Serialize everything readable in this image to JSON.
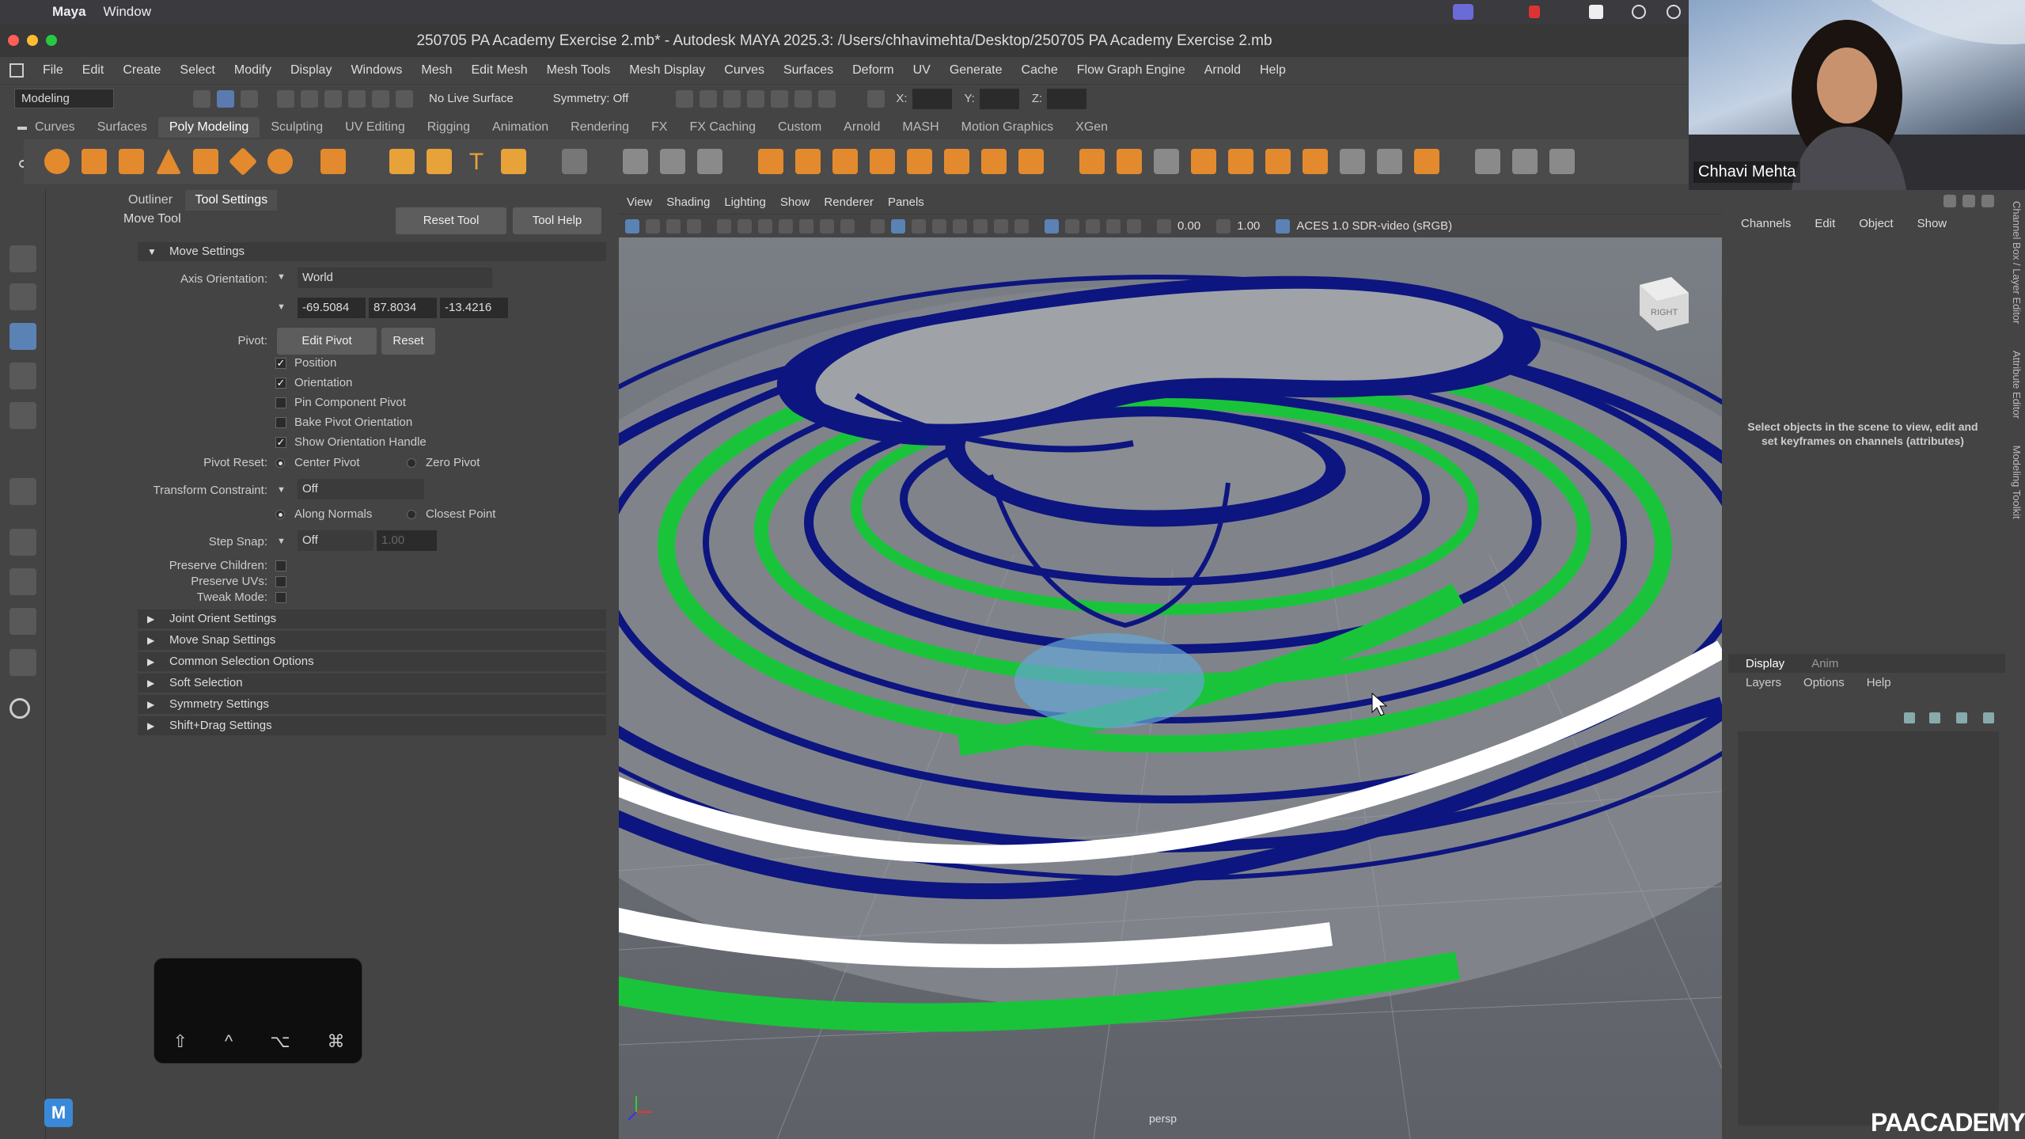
{
  "os_menu": {
    "app": "Maya",
    "window": "Window"
  },
  "window": {
    "title": "250705 PA Academy Exercise 2.mb* - Autodesk MAYA 2025.3: /Users/chhavimehta/Desktop/250705 PA Academy Exercise 2.mb"
  },
  "app_menu": [
    "File",
    "Edit",
    "Create",
    "Select",
    "Modify",
    "Display",
    "Windows",
    "Mesh",
    "Edit Mesh",
    "Mesh Tools",
    "Mesh Display",
    "Curves",
    "Surfaces",
    "Deform",
    "UV",
    "Generate",
    "Cache",
    "Flow Graph Engine",
    "Arnold",
    "Help"
  ],
  "status_line": {
    "workspace": "Modeling",
    "live_surface": "No Live Surface",
    "symmetry": "Symmetry: Off",
    "x_label": "X:",
    "y_label": "Y:",
    "z_label": "Z:"
  },
  "shelf_tabs": [
    "Curves",
    "Surfaces",
    "Poly Modeling",
    "Sculpting",
    "UV Editing",
    "Rigging",
    "Animation",
    "Rendering",
    "FX",
    "FX Caching",
    "Custom",
    "Arnold",
    "MASH",
    "Motion Graphics",
    "XGen"
  ],
  "shelf_active": "Poly Modeling",
  "panel": {
    "tabs": [
      "Outliner",
      "Tool Settings"
    ],
    "tool_name": "Move Tool",
    "reset_tool": "Reset Tool",
    "tool_help": "Tool Help",
    "section_title": "Move Settings",
    "axis_orientation_label": "Axis Orientation:",
    "axis_orientation_value": "World",
    "vec": [
      "-69.5084",
      "87.8034",
      "-13.4216"
    ],
    "pivot_label": "Pivot:",
    "edit_pivot": "Edit Pivot",
    "reset": "Reset",
    "cb_position": "Position",
    "cb_orientation": "Orientation",
    "cb_pin": "Pin Component Pivot",
    "cb_bake": "Bake Pivot Orientation",
    "cb_show": "Show Orientation Handle",
    "pivot_reset_label": "Pivot Reset:",
    "center_pivot": "Center Pivot",
    "zero_pivot": "Zero Pivot",
    "transform_constraint_label": "Transform Constraint:",
    "transform_constraint_value": "Off",
    "along_normals": "Along Normals",
    "closest_point": "Closest Point",
    "step_snap_label": "Step Snap:",
    "step_snap_value": "Off",
    "step_snap_num": "1.00",
    "preserve_children": "Preserve Children:",
    "preserve_uvs": "Preserve UVs:",
    "tweak_mode": "Tweak Mode:",
    "sections": [
      "Joint Orient Settings",
      "Move Snap Settings",
      "Common Selection Options",
      "Soft Selection",
      "Symmetry Settings",
      "Shift+Drag Settings"
    ]
  },
  "viewport": {
    "menu": [
      "View",
      "Shading",
      "Lighting",
      "Show",
      "Renderer",
      "Panels"
    ],
    "exposure": "0.00",
    "gamma": "1.00",
    "color_space": "ACES 1.0 SDR-video (sRGB)",
    "camera": "persp",
    "view_cube": "RIGHT"
  },
  "channel_box": {
    "menu": [
      "Channels",
      "Edit",
      "Object",
      "Show"
    ],
    "hint": "Select objects in the scene to view, edit and set keyframes on channels (attributes)",
    "side_tabs": [
      "Channel Box / Layer Editor",
      "Attribute Editor",
      "Modeling Toolkit"
    ],
    "layer_tabs": [
      "Display",
      "Anim"
    ],
    "layer_menu": [
      "Layers",
      "Options",
      "Help"
    ]
  },
  "webcam": {
    "name": "Chhavi Mehta"
  },
  "keyboard_overlay": [
    "⇧",
    "^",
    "⌥",
    "⌘"
  ],
  "watermark": "PAACADEMY",
  "maya_badge": "M",
  "colors": {
    "accent_green": "#19c43b",
    "wire_blue": "#0d1580",
    "surface_gray": "#8a8d92",
    "viewport_bg": "#6e7379"
  }
}
